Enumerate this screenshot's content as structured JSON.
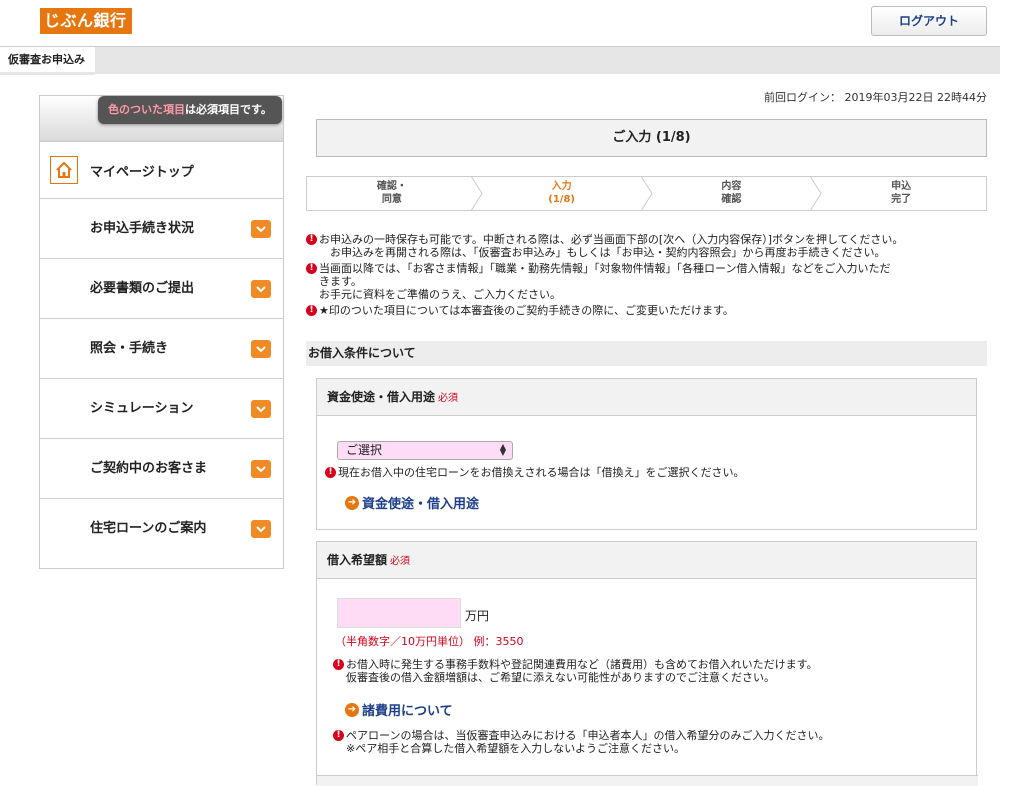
{
  "header": {
    "logo_text": "じぶん銀行",
    "logout_label": "ログアウト"
  },
  "subnav": {
    "current_tab": "仮審査お申込み"
  },
  "sidebar": {
    "tooltip_prefix": "色のついた項目",
    "tooltip_suffix": "は必須項目です。",
    "top_label": "マイページトップ",
    "items": [
      {
        "label": "お申込手続き状況"
      },
      {
        "label": "必要書類のご提出"
      },
      {
        "label": "照会・手続き"
      },
      {
        "label": "シミュレーション"
      },
      {
        "label": "ご契約中のお客さま"
      },
      {
        "label": "住宅ローンのご案内"
      }
    ]
  },
  "main": {
    "last_login": "前回ログイン： 2019年03月22日 22時44分",
    "step_title": "ご入力 (1/8)",
    "steps": [
      {
        "line1": "確認・",
        "line2": "同意"
      },
      {
        "line1": "入力",
        "line2": "(1/8)"
      },
      {
        "line1": "内容",
        "line2": "確認"
      },
      {
        "line1": "申込",
        "line2": "完了"
      }
    ],
    "notes": [
      "お申込みの一時保存も可能です。中断される際は、必ず当画面下部の[次へ（入力内容保存）]ボタンを押してください。\n　お申込みを再開される際は、「仮審査お申込み」もしくは「お申込・契約内容照会」から再度お手続きください。",
      "当画面以降では、「お客さま情報」「職業・勤務先情報」「対象物件情報」「各種ローン借入情報」などをご入力いただ\nきます。\nお手元に資料をご準備のうえ、ご入力ください。",
      "★印のついた項目については本審査後のご契約手続きの際に、ご変更いただけます。"
    ],
    "section_title": "お借入条件について",
    "purpose_panel": {
      "title": "資金使途・借入用途",
      "required": "必須",
      "select_value": "ご選択",
      "note": "現在お借入中の住宅ローンをお借換えされる場合は「借換え」をご選択ください。",
      "link": "資金使途・借入用途"
    },
    "amount_panel": {
      "title": "借入希望額",
      "required": "必須",
      "input_value": "",
      "unit": "万円",
      "hint": "（半角数字／10万円単位） 例：3550",
      "note1": "お借入時に発生する事務手数料や登記関連費用など（諸費用）も含めてお借入れいただけます。\n仮審査後の借入金額増額は、ご希望に添えない可能性がありますのでご注意ください。",
      "link": "諸費用について",
      "note2": "ペアローンの場合は、当仮審査申込みにおける「申込者本人」の借入希望分のみご入力ください。\n※ペア相手と合算した借入希望額を入力しないようご注意ください。"
    }
  },
  "colors": {
    "accent": "#e8760f",
    "required": "#d6001c",
    "link": "#1d3f8a",
    "required_field": "#ffdcf6"
  }
}
